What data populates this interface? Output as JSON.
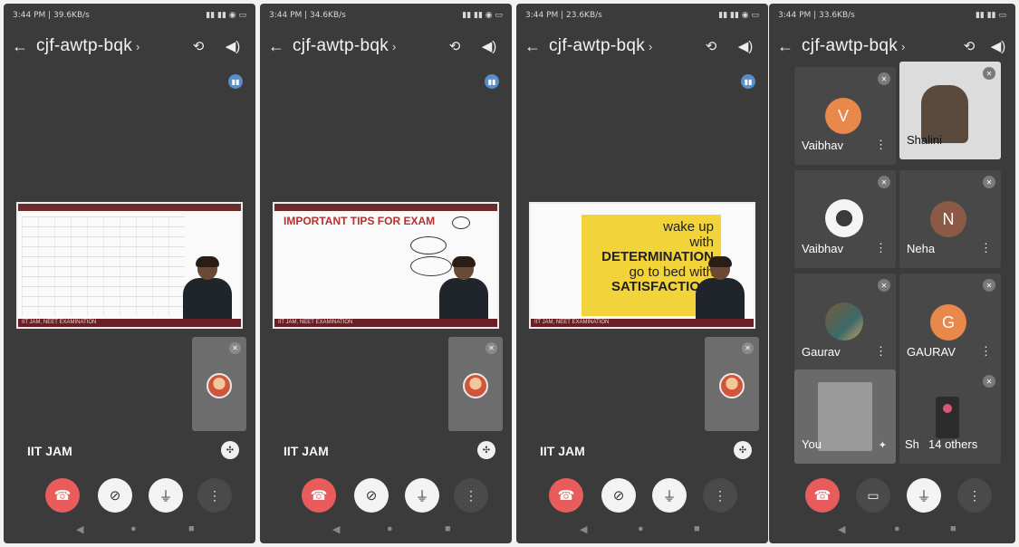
{
  "meeting": {
    "code": "cjf-awtp-bqk"
  },
  "screens": [
    {
      "status_left": "3:44 PM | 39.6KB/s",
      "slide_footer": "IIT JAM, NEET EXAMINATION",
      "caption": "IIT JAM"
    },
    {
      "status_left": "3:44 PM | 34.6KB/s",
      "slide_heading": "IMPORTANT  TIPS FOR EXAM",
      "slide_footer": "IIT JAM, NEET EXAMINATION",
      "caption": "IIT JAM"
    },
    {
      "status_left": "3:44 PM | 23.6KB/s",
      "quote": {
        "line1": "wake up",
        "line2": "with",
        "line3": "DETERMINATION",
        "line4": "go to bed with",
        "line5": "SATISFACTION."
      },
      "slide_footer": "IIT JAM, NEET EXAMINATION",
      "caption": "IIT JAM"
    },
    {
      "status_left": "3:44 PM | 33.6KB/s",
      "participants": [
        {
          "name": "Vaibhav",
          "initial": "V",
          "color": "#e8884a"
        },
        {
          "name": "Shalini",
          "initial": ""
        },
        {
          "name": "Vaibhav",
          "initial": ""
        },
        {
          "name": "Neha",
          "initial": "N",
          "color": "#8b5a46"
        },
        {
          "name": "Gaurav",
          "initial": ""
        },
        {
          "name": "GAURAV",
          "initial": "G",
          "color": "#e8884a"
        },
        {
          "name": "You",
          "initial": ""
        },
        {
          "name": "Sh",
          "initial": "",
          "overflow": "14 others"
        }
      ]
    }
  ],
  "icons": {
    "back": "arrow-left-icon",
    "switch_camera": "switch-camera-icon",
    "speaker": "speaker-icon",
    "hang_up": "end-call-icon",
    "camera_off": "camera-off-icon",
    "mic_off": "mic-off-icon",
    "more": "more-vert-icon"
  },
  "colors": {
    "end_call": "#e85c5c",
    "background": "#3b3b3b",
    "slide_footer": "#6a1f28"
  }
}
